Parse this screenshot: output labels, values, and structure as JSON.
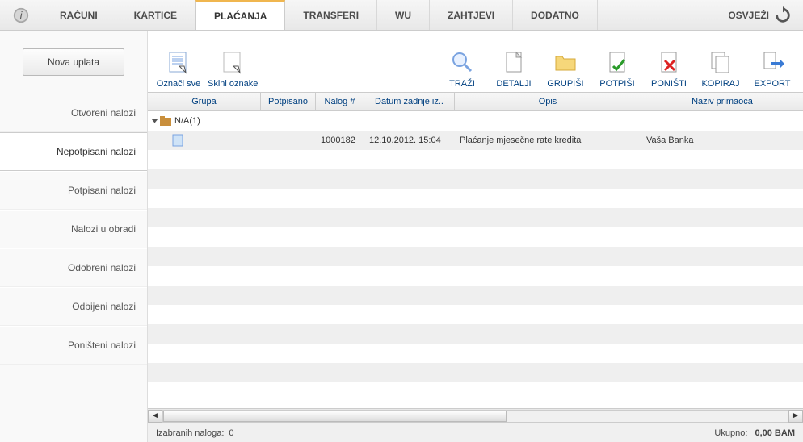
{
  "topnav": {
    "tabs": [
      "RAČUNI",
      "KARTICE",
      "PLAĆANJA",
      "TRANSFERI",
      "WU",
      "ZAHTJEVI",
      "DODATNO"
    ],
    "active_index": 2,
    "refresh_label": "OSVJEŽI"
  },
  "sidebar": {
    "new_button": "Nova uplata",
    "items": [
      "Otvoreni nalozi",
      "Nepotpisani nalozi",
      "Potpisani nalozi",
      "Nalozi u obradi",
      "Odobreni nalozi",
      "Odbijeni nalozi",
      "Poništeni nalozi"
    ],
    "active_index": 1
  },
  "toolbar": {
    "select_all": "Označi sve",
    "deselect_all": "Skini oznake",
    "search": "TRAŽI",
    "details": "DETALJI",
    "group": "GRUPIŠI",
    "sign": "POTPIŠI",
    "cancel": "PONIŠTI",
    "copy": "KOPIRAJ",
    "export": "EXPORT"
  },
  "grid": {
    "headers": {
      "grupa": "Grupa",
      "potpisano": "Potpisano",
      "nalog": "Nalog #",
      "datum": "Datum zadnje iz..",
      "opis": "Opis",
      "naziv": "Naziv primaoca"
    },
    "group_label": "N/A(1)",
    "rows": [
      {
        "nalog": "1000182",
        "datum": "12.10.2012. 15:04",
        "opis": "Plaćanje mjesečne rate kredita",
        "naziv": "Vaša Banka"
      }
    ]
  },
  "footer": {
    "selected_label": "Izabranih naloga:",
    "selected_count": "0",
    "total_label": "Ukupno:",
    "total_value": "0,00 BAM"
  }
}
